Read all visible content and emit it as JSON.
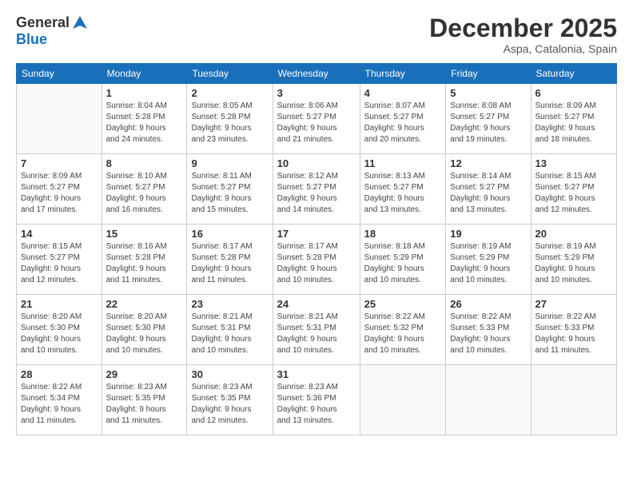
{
  "logo": {
    "general": "General",
    "blue": "Blue"
  },
  "header": {
    "title": "December 2025",
    "location": "Aspa, Catalonia, Spain"
  },
  "weekdays": [
    "Sunday",
    "Monday",
    "Tuesday",
    "Wednesday",
    "Thursday",
    "Friday",
    "Saturday"
  ],
  "weeks": [
    [
      {
        "day": "",
        "info": ""
      },
      {
        "day": "1",
        "info": "Sunrise: 8:04 AM\nSunset: 5:28 PM\nDaylight: 9 hours\nand 24 minutes."
      },
      {
        "day": "2",
        "info": "Sunrise: 8:05 AM\nSunset: 5:28 PM\nDaylight: 9 hours\nand 23 minutes."
      },
      {
        "day": "3",
        "info": "Sunrise: 8:06 AM\nSunset: 5:27 PM\nDaylight: 9 hours\nand 21 minutes."
      },
      {
        "day": "4",
        "info": "Sunrise: 8:07 AM\nSunset: 5:27 PM\nDaylight: 9 hours\nand 20 minutes."
      },
      {
        "day": "5",
        "info": "Sunrise: 8:08 AM\nSunset: 5:27 PM\nDaylight: 9 hours\nand 19 minutes."
      },
      {
        "day": "6",
        "info": "Sunrise: 8:09 AM\nSunset: 5:27 PM\nDaylight: 9 hours\nand 18 minutes."
      }
    ],
    [
      {
        "day": "7",
        "info": "Sunrise: 8:09 AM\nSunset: 5:27 PM\nDaylight: 9 hours\nand 17 minutes."
      },
      {
        "day": "8",
        "info": "Sunrise: 8:10 AM\nSunset: 5:27 PM\nDaylight: 9 hours\nand 16 minutes."
      },
      {
        "day": "9",
        "info": "Sunrise: 8:11 AM\nSunset: 5:27 PM\nDaylight: 9 hours\nand 15 minutes."
      },
      {
        "day": "10",
        "info": "Sunrise: 8:12 AM\nSunset: 5:27 PM\nDaylight: 9 hours\nand 14 minutes."
      },
      {
        "day": "11",
        "info": "Sunrise: 8:13 AM\nSunset: 5:27 PM\nDaylight: 9 hours\nand 13 minutes."
      },
      {
        "day": "12",
        "info": "Sunrise: 8:14 AM\nSunset: 5:27 PM\nDaylight: 9 hours\nand 13 minutes."
      },
      {
        "day": "13",
        "info": "Sunrise: 8:15 AM\nSunset: 5:27 PM\nDaylight: 9 hours\nand 12 minutes."
      }
    ],
    [
      {
        "day": "14",
        "info": "Sunrise: 8:15 AM\nSunset: 5:27 PM\nDaylight: 9 hours\nand 12 minutes."
      },
      {
        "day": "15",
        "info": "Sunrise: 8:16 AM\nSunset: 5:28 PM\nDaylight: 9 hours\nand 11 minutes."
      },
      {
        "day": "16",
        "info": "Sunrise: 8:17 AM\nSunset: 5:28 PM\nDaylight: 9 hours\nand 11 minutes."
      },
      {
        "day": "17",
        "info": "Sunrise: 8:17 AM\nSunset: 5:28 PM\nDaylight: 9 hours\nand 10 minutes."
      },
      {
        "day": "18",
        "info": "Sunrise: 8:18 AM\nSunset: 5:29 PM\nDaylight: 9 hours\nand 10 minutes."
      },
      {
        "day": "19",
        "info": "Sunrise: 8:19 AM\nSunset: 5:29 PM\nDaylight: 9 hours\nand 10 minutes."
      },
      {
        "day": "20",
        "info": "Sunrise: 8:19 AM\nSunset: 5:29 PM\nDaylight: 9 hours\nand 10 minutes."
      }
    ],
    [
      {
        "day": "21",
        "info": "Sunrise: 8:20 AM\nSunset: 5:30 PM\nDaylight: 9 hours\nand 10 minutes."
      },
      {
        "day": "22",
        "info": "Sunrise: 8:20 AM\nSunset: 5:30 PM\nDaylight: 9 hours\nand 10 minutes."
      },
      {
        "day": "23",
        "info": "Sunrise: 8:21 AM\nSunset: 5:31 PM\nDaylight: 9 hours\nand 10 minutes."
      },
      {
        "day": "24",
        "info": "Sunrise: 8:21 AM\nSunset: 5:31 PM\nDaylight: 9 hours\nand 10 minutes."
      },
      {
        "day": "25",
        "info": "Sunrise: 8:22 AM\nSunset: 5:32 PM\nDaylight: 9 hours\nand 10 minutes."
      },
      {
        "day": "26",
        "info": "Sunrise: 8:22 AM\nSunset: 5:33 PM\nDaylight: 9 hours\nand 10 minutes."
      },
      {
        "day": "27",
        "info": "Sunrise: 8:22 AM\nSunset: 5:33 PM\nDaylight: 9 hours\nand 11 minutes."
      }
    ],
    [
      {
        "day": "28",
        "info": "Sunrise: 8:22 AM\nSunset: 5:34 PM\nDaylight: 9 hours\nand 11 minutes."
      },
      {
        "day": "29",
        "info": "Sunrise: 8:23 AM\nSunset: 5:35 PM\nDaylight: 9 hours\nand 11 minutes."
      },
      {
        "day": "30",
        "info": "Sunrise: 8:23 AM\nSunset: 5:35 PM\nDaylight: 9 hours\nand 12 minutes."
      },
      {
        "day": "31",
        "info": "Sunrise: 8:23 AM\nSunset: 5:36 PM\nDaylight: 9 hours\nand 13 minutes."
      },
      {
        "day": "",
        "info": ""
      },
      {
        "day": "",
        "info": ""
      },
      {
        "day": "",
        "info": ""
      }
    ]
  ]
}
